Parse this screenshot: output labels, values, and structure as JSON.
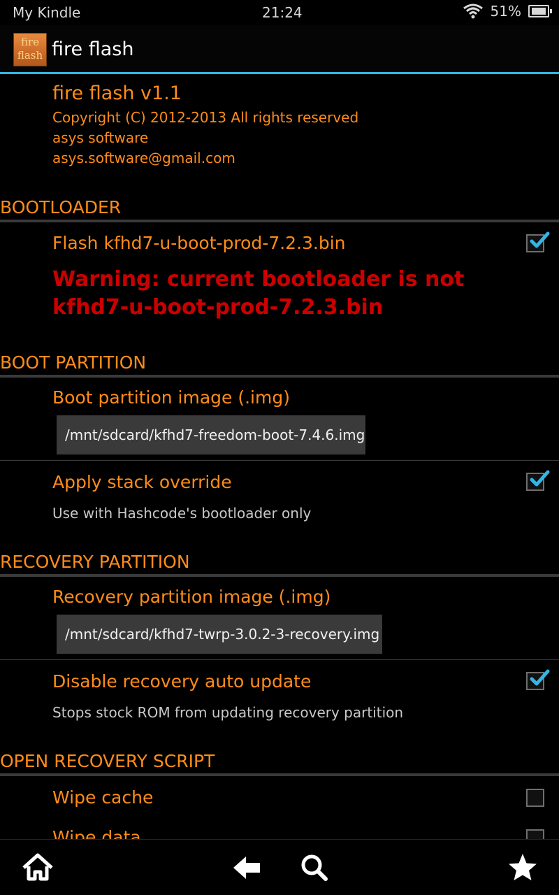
{
  "status": {
    "carrier": "My Kindle",
    "time": "21:24",
    "battery": "51%"
  },
  "app": {
    "icon_text_line1": "fire",
    "icon_text_line2": "flash",
    "title": "fire flash"
  },
  "about": {
    "title": "fire flash v1.1",
    "copyright": "Copyright (C) 2012-2013 All rights reserved",
    "company": "asys software",
    "email": "asys.software@gmail.com"
  },
  "bootloader": {
    "header": "BOOTLOADER",
    "flash_label": "Flash kfhd7-u-boot-prod-7.2.3.bin",
    "flash_checked": true,
    "warning": "Warning: current bootloader is not kfhd7-u-boot-prod-7.2.3.bin"
  },
  "boot_partition": {
    "header": "BOOT PARTITION",
    "image_label": "Boot partition image (.img)",
    "image_path": "/mnt/sdcard/kfhd7-freedom-boot-7.4.6.img",
    "stack_label": "Apply stack override",
    "stack_summary": "Use with Hashcode's bootloader only",
    "stack_checked": true
  },
  "recovery_partition": {
    "header": "RECOVERY PARTITION",
    "image_label": "Recovery partition image (.img)",
    "image_path": "/mnt/sdcard/kfhd7-twrp-3.0.2-3-recovery.img",
    "auto_update_label": "Disable recovery auto update",
    "auto_update_summary": "Stops stock ROM from updating recovery partition",
    "auto_update_checked": true
  },
  "open_recovery_script": {
    "header": "OPEN RECOVERY SCRIPT",
    "wipe_cache_label": "Wipe cache",
    "wipe_cache_checked": false,
    "wipe_data_label": "Wipe data",
    "wipe_data_checked": false
  },
  "navbar": {
    "home": "home-icon",
    "back": "back-icon",
    "search": "search-icon",
    "favorites": "star-icon"
  },
  "colors": {
    "accent": "#33b5e5",
    "text": "#ff8c19",
    "warning": "#cc0000"
  }
}
